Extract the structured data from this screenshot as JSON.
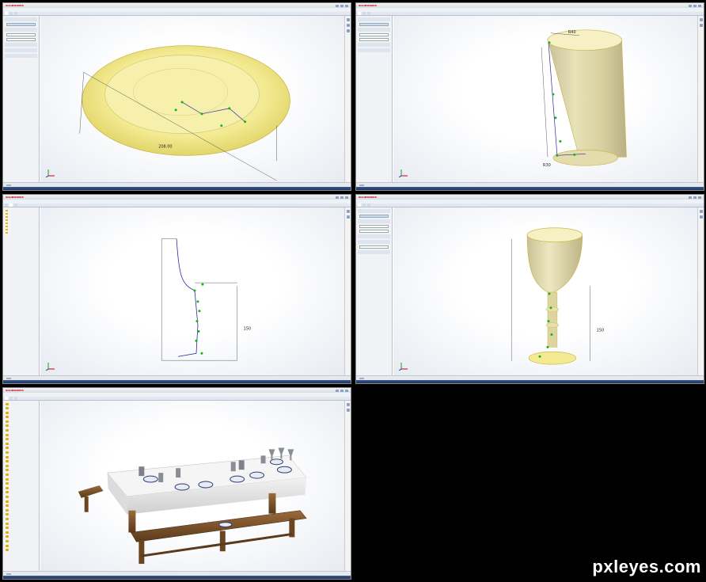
{
  "app": {
    "logo": "SOLIDWORKS"
  },
  "panels": [
    {
      "id": "plate",
      "title": "",
      "doc": "",
      "status": ""
    },
    {
      "id": "glass",
      "title": "",
      "doc": "",
      "status": ""
    },
    {
      "id": "goblet-sketch",
      "title": "",
      "doc": "",
      "status": ""
    },
    {
      "id": "goblet",
      "title": "",
      "doc": "",
      "status": ""
    },
    {
      "id": "table",
      "title": "",
      "doc": "",
      "status": ""
    }
  ],
  "dimensions": {
    "plate_diameter": "208.00",
    "glass_top": "R40",
    "glass_bottom": "R30",
    "goblet_height": "150"
  },
  "colors": {
    "part_fill": "#f3ea92",
    "part_edge": "#c9b84a",
    "sketch_line": "#2a2aa0",
    "point": "#18b018"
  },
  "watermark": "pxleyes.com"
}
